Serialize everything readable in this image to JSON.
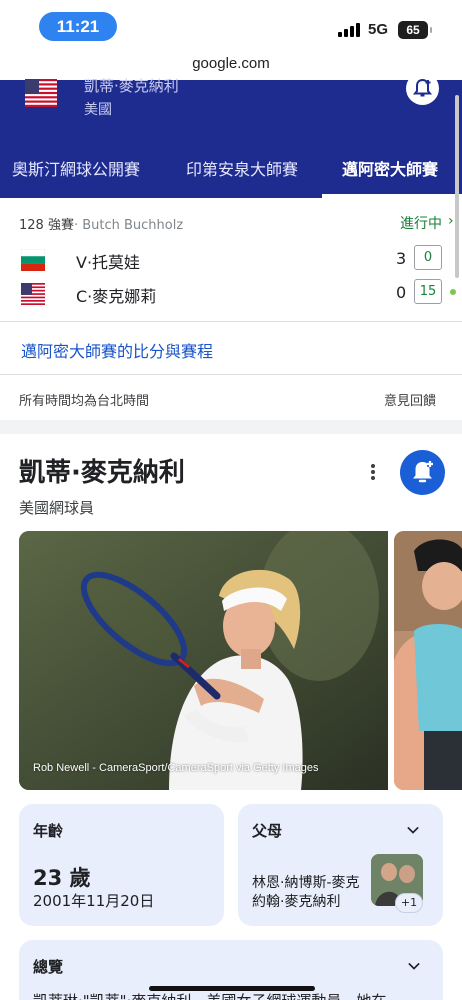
{
  "status_bar": {
    "time": "11:21",
    "network": "5G",
    "battery": "65"
  },
  "browser": {
    "url": "google.com"
  },
  "banner": {
    "player_name": "凱蒂·麥克納利",
    "player_country": "美國",
    "tabs": [
      {
        "label": "奧斯汀網球公開賽",
        "active": false
      },
      {
        "label": "印第安泉大師賽",
        "active": false
      },
      {
        "label": "邁阿密大師賽",
        "active": true
      }
    ]
  },
  "match": {
    "round": "128 強賽",
    "umpire": "· Butch Buchholz",
    "status": "進行中",
    "players": [
      {
        "name": "V·托莫娃",
        "flag": "bulgaria-flag",
        "sets": "3",
        "game": "0",
        "serving": false
      },
      {
        "name": "C·麥克娜莉",
        "flag": "usa-flag",
        "sets": "0",
        "game": "15",
        "serving": true
      }
    ],
    "scores_link": "邁阿密大師賽的比分與賽程",
    "timezone_note": "所有時間均為台北時間",
    "feedback": "意見回饋"
  },
  "knowledge_panel": {
    "name": "凱蒂·麥克納利",
    "subtitle": "美國網球員",
    "photo_credit": "Rob Newell - CameraSport/CameraSport via Getty Images",
    "age_card": {
      "title": "年齡",
      "value": "23 歲",
      "date": "2001年11月20日"
    },
    "parents_card": {
      "title": "父母",
      "line1": "林恩·納博斯-麥克",
      "line2": "約翰·麥克納利",
      "more": "+1"
    },
    "overview_card": {
      "title": "總覽",
      "text": "凱蒂琳·\"凱蒂\"·麥克納利，美國女子網球運動員。她在"
    }
  },
  "colors": {
    "banner_bg": "#1e2b8f",
    "accent_blue": "#1a5fd6",
    "live_green": "#188038",
    "card_bg": "#e8eefb"
  }
}
